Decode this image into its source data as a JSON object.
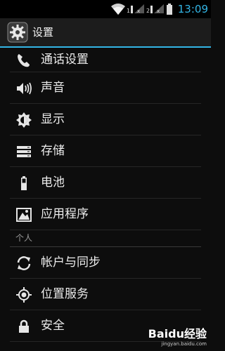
{
  "status_bar": {
    "time": "13:09"
  },
  "action_bar": {
    "title": "设置",
    "icon": "settings-gear-icon"
  },
  "items_top": [
    {
      "label": "通话设置",
      "icon": "phone-icon"
    },
    {
      "label": "声音",
      "icon": "speaker-icon"
    },
    {
      "label": "显示",
      "icon": "brightness-icon"
    },
    {
      "label": "存储",
      "icon": "storage-icon"
    },
    {
      "label": "电池",
      "icon": "battery-icon"
    },
    {
      "label": "应用程序",
      "icon": "apps-icon"
    }
  ],
  "section_personal": "个人",
  "items_personal": [
    {
      "label": "帐户与同步",
      "icon": "sync-icon"
    },
    {
      "label": "位置服务",
      "icon": "location-icon"
    },
    {
      "label": "安全",
      "icon": "lock-icon"
    }
  ],
  "watermark": {
    "logo": "Baidu经验",
    "url": "jingyan.baidu.com"
  },
  "colors": {
    "accent": "#33b5e5",
    "background": "#0d0d0d"
  }
}
